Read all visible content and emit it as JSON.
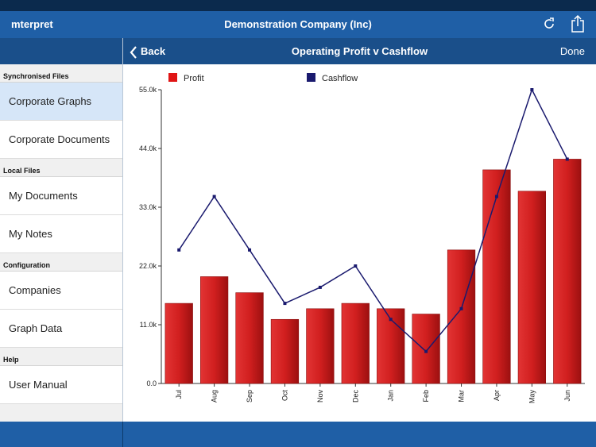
{
  "header": {
    "app_name": "mterpret",
    "company": "Demonstration Company (Inc)",
    "refresh_icon": "refresh-icon",
    "share_icon": "share-icon"
  },
  "sidebar": {
    "sections": [
      {
        "title": "Synchronised Files",
        "items": [
          {
            "label": "Corporate Graphs",
            "selected": true
          },
          {
            "label": "Corporate Documents"
          }
        ]
      },
      {
        "title": "Local Files",
        "items": [
          {
            "label": "My Documents"
          },
          {
            "label": "My Notes"
          }
        ]
      },
      {
        "title": "Configuration",
        "items": [
          {
            "label": "Companies"
          },
          {
            "label": "Graph Data"
          }
        ]
      },
      {
        "title": "Help",
        "items": [
          {
            "label": "User Manual"
          }
        ]
      }
    ]
  },
  "nav": {
    "back_label": "Back",
    "title": "Operating Profit v Cashflow",
    "done_label": "Done"
  },
  "colors": {
    "bar": "#d11f1f",
    "line": "#1a1a6e",
    "accent": "#1f5fa6"
  },
  "chart_data": {
    "type": "bar",
    "categories": [
      "Jul",
      "Aug",
      "Sep",
      "Oct",
      "Nov",
      "Dec",
      "Jan",
      "Feb",
      "Mar",
      "Apr",
      "May",
      "Jun"
    ],
    "series": [
      {
        "name": "Profit",
        "type": "bar",
        "values": [
          15000,
          20000,
          17000,
          12000,
          14000,
          15000,
          14000,
          13000,
          25000,
          40000,
          36000,
          42000
        ]
      },
      {
        "name": "Cashflow",
        "type": "line",
        "values": [
          25000,
          35000,
          25000,
          15000,
          18000,
          22000,
          12000,
          6000,
          14000,
          35000,
          55000,
          42000
        ]
      }
    ],
    "yticks": [
      "0.0",
      "11.0k",
      "22.0k",
      "33.0k",
      "44.0k",
      "55.0k"
    ],
    "ylim": [
      0,
      55000
    ],
    "grid": false,
    "legend_position": "top"
  }
}
